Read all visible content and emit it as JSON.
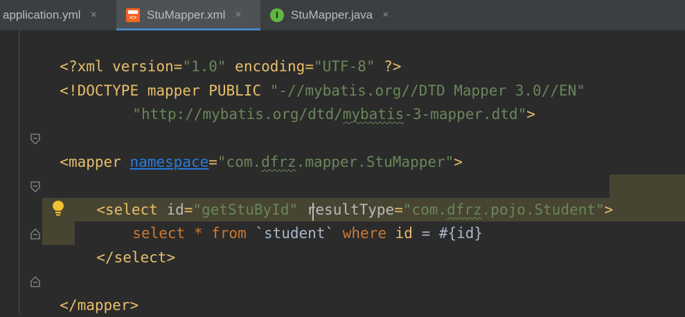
{
  "tabs": [
    {
      "label": "application.yml",
      "active": false
    },
    {
      "label": "StuMapper.xml",
      "active": true,
      "icon": "xml-file-icon"
    },
    {
      "label": "StuMapper.java",
      "active": false,
      "icon": "java-interface-icon",
      "icon_letter": "I"
    }
  ],
  "close_glyph": "×",
  "editor": {
    "lines": {
      "l1": {
        "a": "<?xml version=",
        "b": "\"1.0\"",
        "c": " encoding=",
        "d": "\"UTF-8\"",
        "e": " ?>"
      },
      "l2": {
        "a": "<!DOCTYPE ",
        "b": "mapper PUBLIC ",
        "c": "\"-//mybatis.org//DTD Mapper 3.0//EN\""
      },
      "l3": {
        "a": "\"http://mybatis.org/dtd/",
        "b": "mybatis",
        "c": "-3-mapper.dtd\"",
        "d": ">"
      },
      "l5": {
        "a": "<mapper ",
        "b": "namespace",
        "c": "=",
        "d": "\"com.",
        "e": "dfrz",
        "f": ".mapper.StuMapper\"",
        "g": ">"
      },
      "l7": {
        "a": "<select ",
        "b": "id",
        "c": "=",
        "d": "\"getStuById\"",
        "e": " resultType",
        "f": "=",
        "g": "\"com.",
        "h": "dfrz",
        "i": ".pojo.Student\"",
        "j": ">"
      },
      "l8": {
        "a": "select ",
        "b": "* ",
        "c": "from ",
        "d": "`student` ",
        "e": "where ",
        "f": "id ",
        "g": "= ",
        "h": "#{id}"
      },
      "l9": {
        "a": "</select>"
      },
      "l11": {
        "a": "</mapper>"
      }
    }
  },
  "colors": {
    "background": "#2b2b2b",
    "tag": "#e8bf6a",
    "string": "#6a8759",
    "keyword": "#cc7832",
    "highlight": "#474432",
    "active_tab_underline": "#4a88c7"
  }
}
